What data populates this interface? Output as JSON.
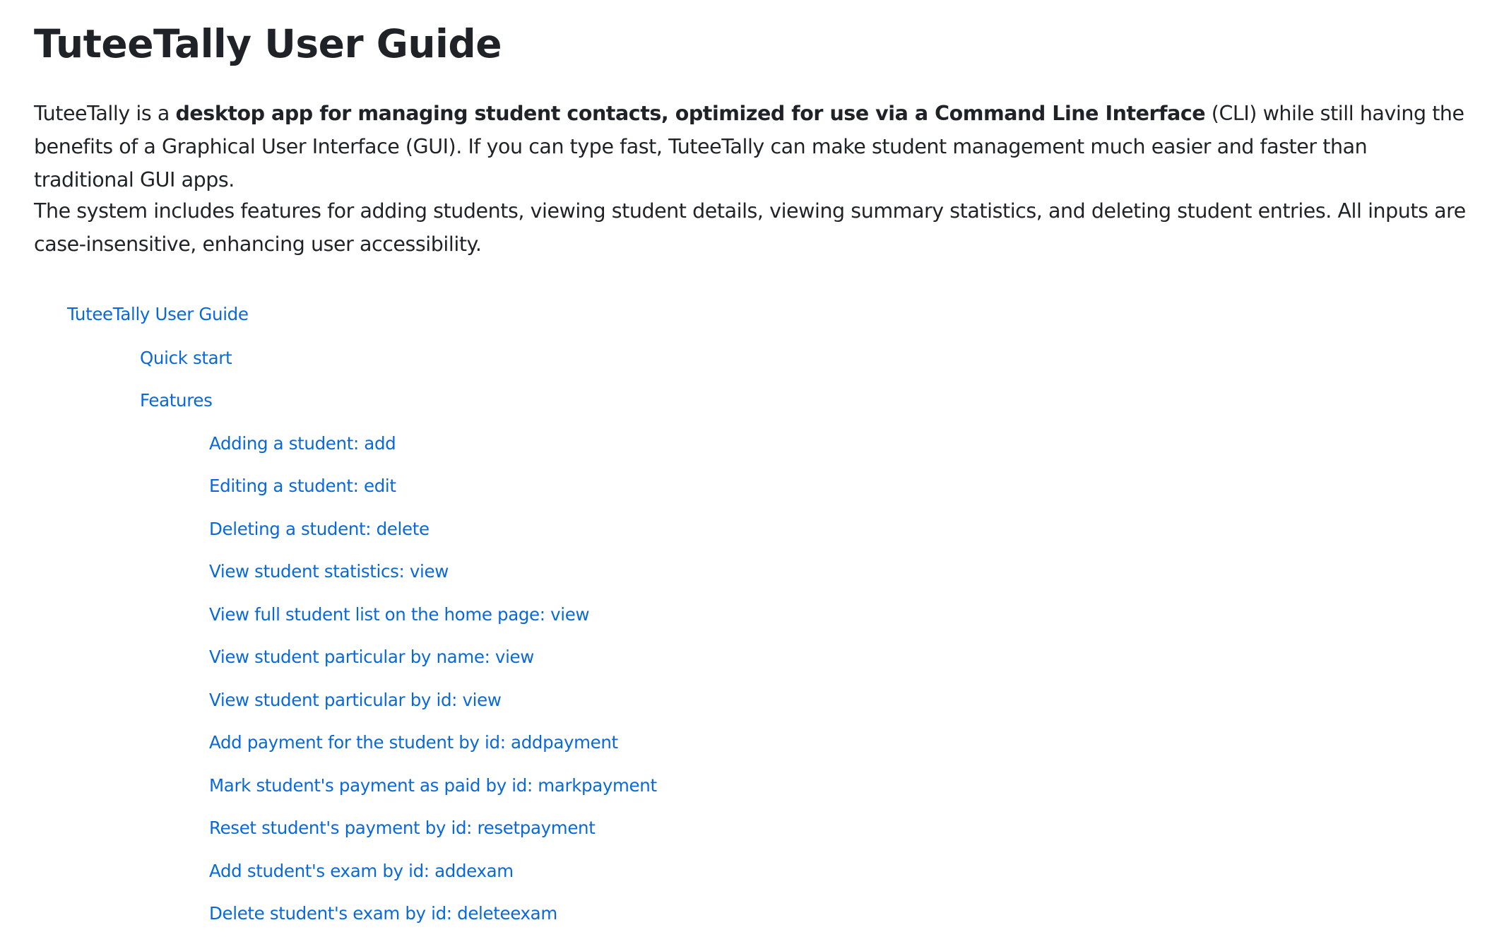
{
  "doc": {
    "title": "TuteeTally User Guide",
    "intro": {
      "pre": "TuteeTally is a ",
      "bold": "desktop app for managing student contacts, optimized for use via a Command Line Interface",
      "post": " (CLI) while still having the benefits of a Graphical User Interface (GUI). If you can type fast, TuteeTally can make student management much easier and faster than traditional GUI apps."
    },
    "scope": "The system includes features for adding students, viewing student details, viewing summary statistics, and deleting student entries. All inputs are case-insensitive, enhancing user accessibility."
  },
  "toc": {
    "root": "TuteeTally User Guide",
    "quick_start": "Quick start",
    "features": "Features",
    "feature_items": [
      "Adding a student: add",
      "Editing a student: edit",
      "Deleting a student: delete",
      "View student statistics: view",
      "View full student list on the home page: view",
      "View student particular by name: view",
      "View student particular by id: view",
      "Add payment for the student by id: addpayment",
      "Mark student's payment as paid by id: markpayment",
      "Reset student's payment by id: resetpayment",
      "Add student's exam by id: addexam",
      "Delete student's exam by id: deleteexam"
    ]
  },
  "colors": {
    "link": "#0969da",
    "text": "#1f2328"
  }
}
